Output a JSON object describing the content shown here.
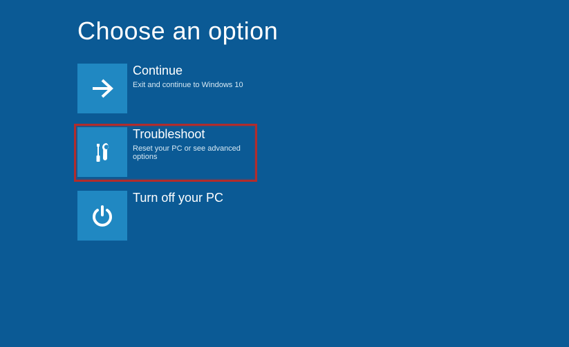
{
  "page_title": "Choose an option",
  "options": {
    "continue": {
      "title": "Continue",
      "subtitle": "Exit and continue to Windows 10",
      "highlighted": false
    },
    "troubleshoot": {
      "title": "Troubleshoot",
      "subtitle": "Reset your PC or see advanced options",
      "highlighted": true
    },
    "turnoff": {
      "title": "Turn off your PC",
      "subtitle": "",
      "highlighted": false
    }
  },
  "colors": {
    "background": "#0b5a95",
    "tile": "#2088c2",
    "highlight_border": "#b22c2c"
  }
}
